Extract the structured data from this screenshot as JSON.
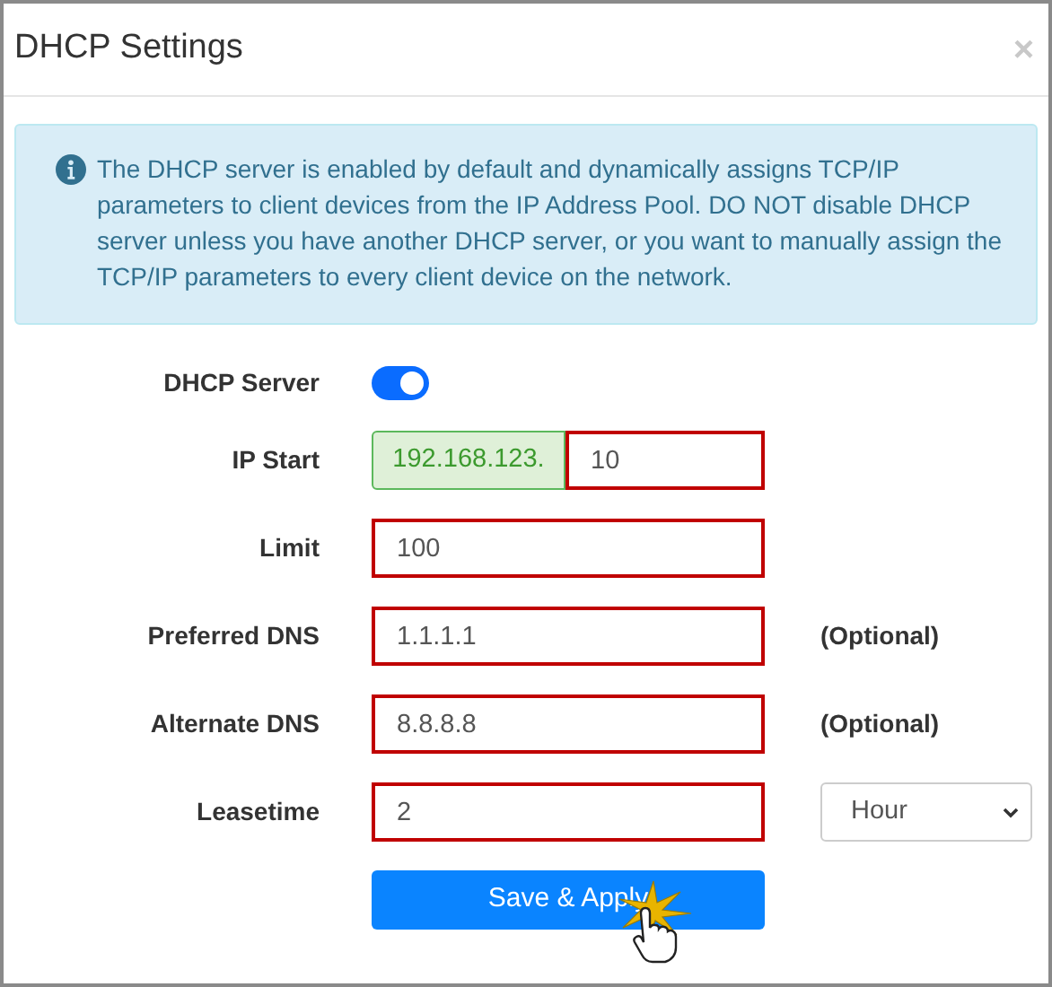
{
  "dialog": {
    "title": "DHCP Settings",
    "close": "×"
  },
  "alert": {
    "text": "The DHCP server is enabled by default and dynamically assigns TCP/IP parameters to client devices from the IP Address Pool. DO NOT disable DHCP server unless you have another DHCP server, or you want to manually assign the TCP/IP parameters to every client device on the network."
  },
  "fields": [
    {
      "kind": "toggle",
      "label": "DHCP Server",
      "on": true
    },
    {
      "kind": "prefixed",
      "label": "IP Start",
      "prefix": "192.168.123.",
      "value": "10"
    },
    {
      "kind": "text",
      "label": "Limit",
      "value": "100"
    },
    {
      "kind": "text",
      "label": "Preferred DNS",
      "value": "1.1.1.1",
      "note": "(Optional)"
    },
    {
      "kind": "text",
      "label": "Alternate DNS",
      "value": "8.8.8.8",
      "note": "(Optional)"
    },
    {
      "kind": "select",
      "label": "Leasetime",
      "value": "2",
      "unit": "Hour"
    }
  ],
  "button": "Save & Apply"
}
